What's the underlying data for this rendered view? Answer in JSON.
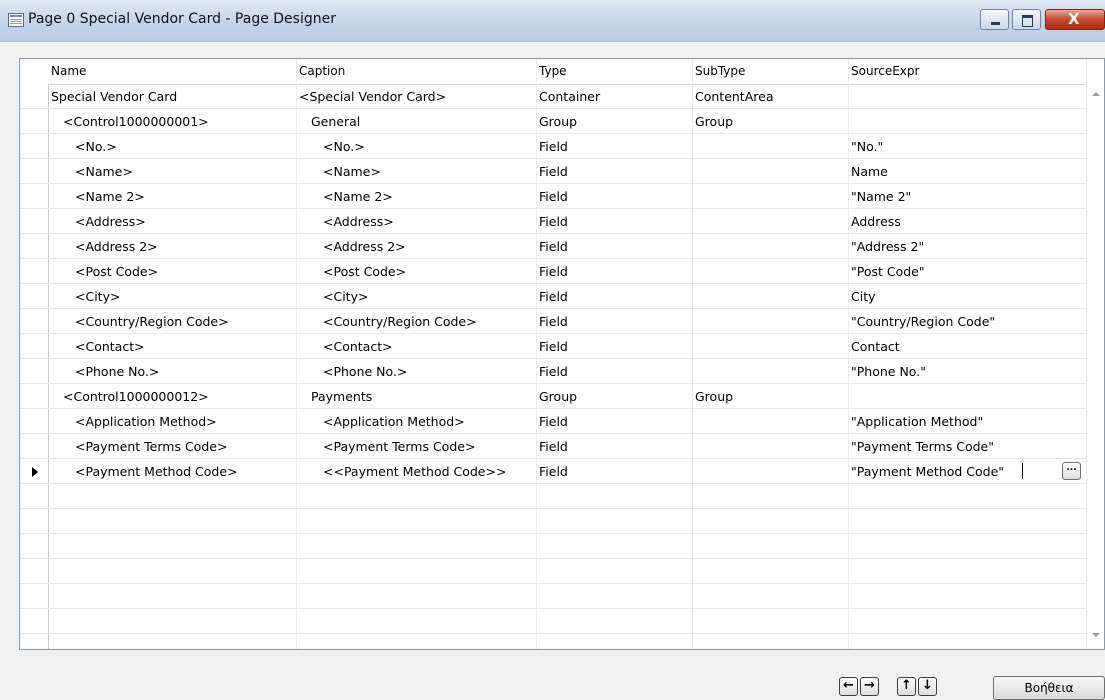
{
  "window": {
    "title": "Page 0 Special Vendor Card - Page Designer",
    "close_glyph": "X"
  },
  "columns": [
    "Name",
    "Caption",
    "Type",
    "SubType",
    "SourceExpr"
  ],
  "rows": [
    {
      "name": "Special Vendor Card",
      "caption": "<Special Vendor Card>",
      "type": "Container",
      "subtype": "ContentArea",
      "source": ""
    },
    {
      "name": "<Control1000000001>",
      "caption": "General",
      "type": "Group",
      "subtype": "Group",
      "source": ""
    },
    {
      "name": "<No.>",
      "caption": "<No.>",
      "type": "Field",
      "subtype": "",
      "source": "\"No.\""
    },
    {
      "name": "<Name>",
      "caption": "<Name>",
      "type": "Field",
      "subtype": "",
      "source": "Name"
    },
    {
      "name": "<Name 2>",
      "caption": "<Name 2>",
      "type": "Field",
      "subtype": "",
      "source": "\"Name 2\""
    },
    {
      "name": "<Address>",
      "caption": "<Address>",
      "type": "Field",
      "subtype": "",
      "source": "Address"
    },
    {
      "name": "<Address 2>",
      "caption": "<Address 2>",
      "type": "Field",
      "subtype": "",
      "source": "\"Address 2\""
    },
    {
      "name": "<Post Code>",
      "caption": "<Post Code>",
      "type": "Field",
      "subtype": "",
      "source": "\"Post Code\""
    },
    {
      "name": "<City>",
      "caption": "<City>",
      "type": "Field",
      "subtype": "",
      "source": "City"
    },
    {
      "name": "<Country/Region Code>",
      "caption": "<Country/Region Code>",
      "type": "Field",
      "subtype": "",
      "source": "\"Country/Region Code\""
    },
    {
      "name": "<Contact>",
      "caption": "<Contact>",
      "type": "Field",
      "subtype": "",
      "source": "Contact"
    },
    {
      "name": "<Phone No.>",
      "caption": "<Phone No.>",
      "type": "Field",
      "subtype": "",
      "source": "\"Phone No.\""
    },
    {
      "name": "<Control1000000012>",
      "caption": "Payments",
      "type": "Group",
      "subtype": "Group",
      "source": ""
    },
    {
      "name": "<Application Method>",
      "caption": "<Application Method>",
      "type": "Field",
      "subtype": "",
      "source": "\"Application Method\""
    },
    {
      "name": "<Payment Terms Code>",
      "caption": "<Payment Terms Code>",
      "type": "Field",
      "subtype": "",
      "source": "\"Payment Terms Code\""
    },
    {
      "name": "<Payment Method Code>",
      "caption": "<<Payment Method Code>>",
      "type": "Field",
      "subtype": "",
      "source": "\"Payment Method Code\""
    }
  ],
  "lookup_button": "...",
  "buttons": {
    "left": "←",
    "right": "→",
    "up": "↑",
    "down": "↓",
    "help": "Βοήθεια"
  }
}
